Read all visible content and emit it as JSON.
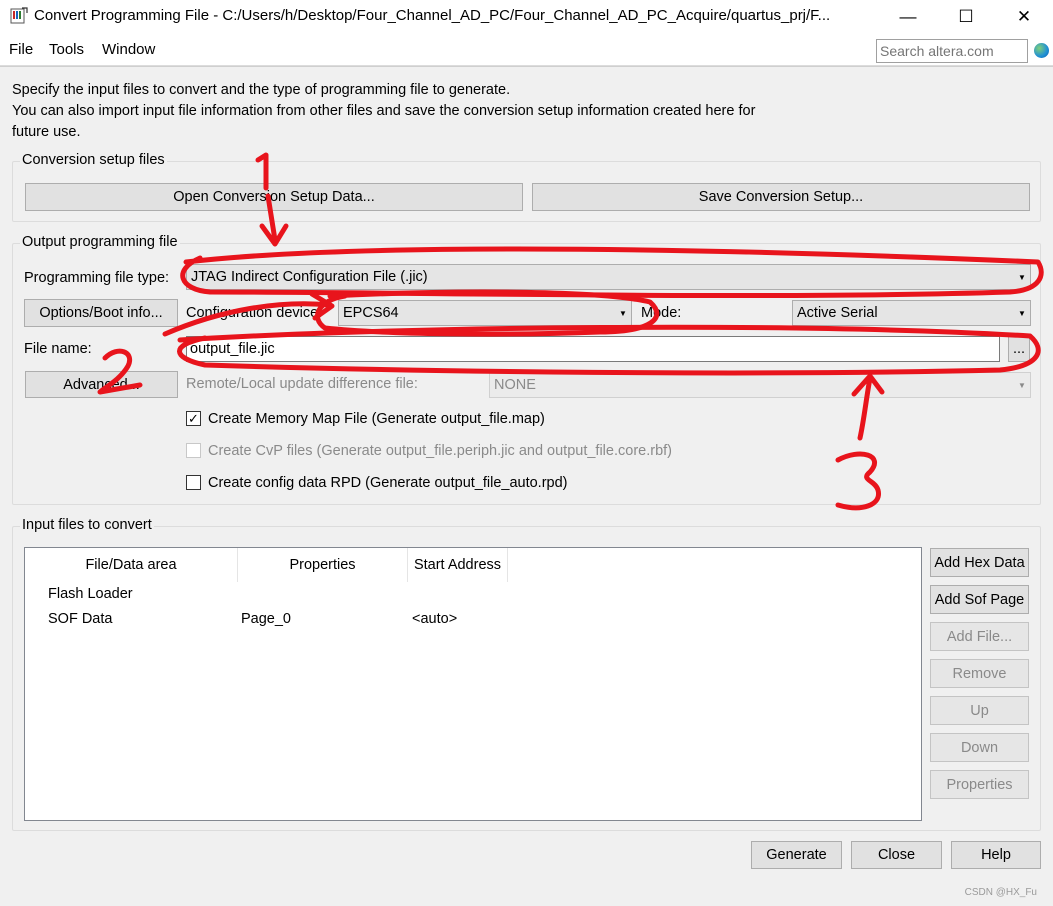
{
  "window": {
    "title": "Convert Programming File - C:/Users/h/Desktop/Four_Channel_AD_PC/Four_Channel_AD_PC_Acquire/quartus_prj/F...",
    "minimize": "—",
    "maximize": "☐",
    "close": "✕"
  },
  "menu": {
    "file": "File",
    "tools": "Tools",
    "window": "Window"
  },
  "search": {
    "placeholder": "Search altera.com"
  },
  "intro": {
    "line1": "Specify the input files to convert and the type of programming file to generate.",
    "line2": "You can also import input file information from other files and save the conversion setup information created here for",
    "line3": "future use."
  },
  "setup_group": {
    "title": "Conversion setup files",
    "open_button": "Open Conversion Setup Data...",
    "save_button": "Save Conversion Setup..."
  },
  "output_group": {
    "title": "Output programming file",
    "file_type_label": "Programming file type:",
    "file_type_value": "JTAG Indirect Configuration File (.jic)",
    "options_button": "Options/Boot info...",
    "config_device_label": "Configuration device:",
    "config_device_value": "EPCS64",
    "mode_label": "Mode:",
    "mode_value": "Active Serial",
    "file_name_label": "File name:",
    "file_name_value": "output_file.jic",
    "browse_button": "...",
    "advanced_button": "Advanced...",
    "remote_label": "Remote/Local update difference file:",
    "remote_value": "NONE",
    "check_map": "Create Memory Map File (Generate output_file.map)",
    "check_cvp": "Create CvP files (Generate output_file.periph.jic and output_file.core.rbf)",
    "check_rpd": "Create config data RPD (Generate output_file_auto.rpd)",
    "check_map_state": true,
    "check_cvp_state": false,
    "check_rpd_state": false
  },
  "input_group": {
    "title": "Input files to convert",
    "columns": [
      "File/Data area",
      "Properties",
      "Start Address"
    ],
    "rows": [
      {
        "area": "Flash Loader",
        "properties": "",
        "address": ""
      },
      {
        "area": "SOF Data",
        "properties": "Page_0",
        "address": "<auto>"
      }
    ],
    "buttons": {
      "add_hex": "Add Hex Data",
      "add_sof": "Add Sof Page",
      "add_file": "Add File...",
      "remove": "Remove",
      "up": "Up",
      "down": "Down",
      "properties": "Properties"
    }
  },
  "bottom_buttons": {
    "generate": "Generate",
    "close": "Close",
    "help": "Help"
  },
  "watermark": "CSDN @HX_Fu",
  "annotation_color": "#e8141c"
}
